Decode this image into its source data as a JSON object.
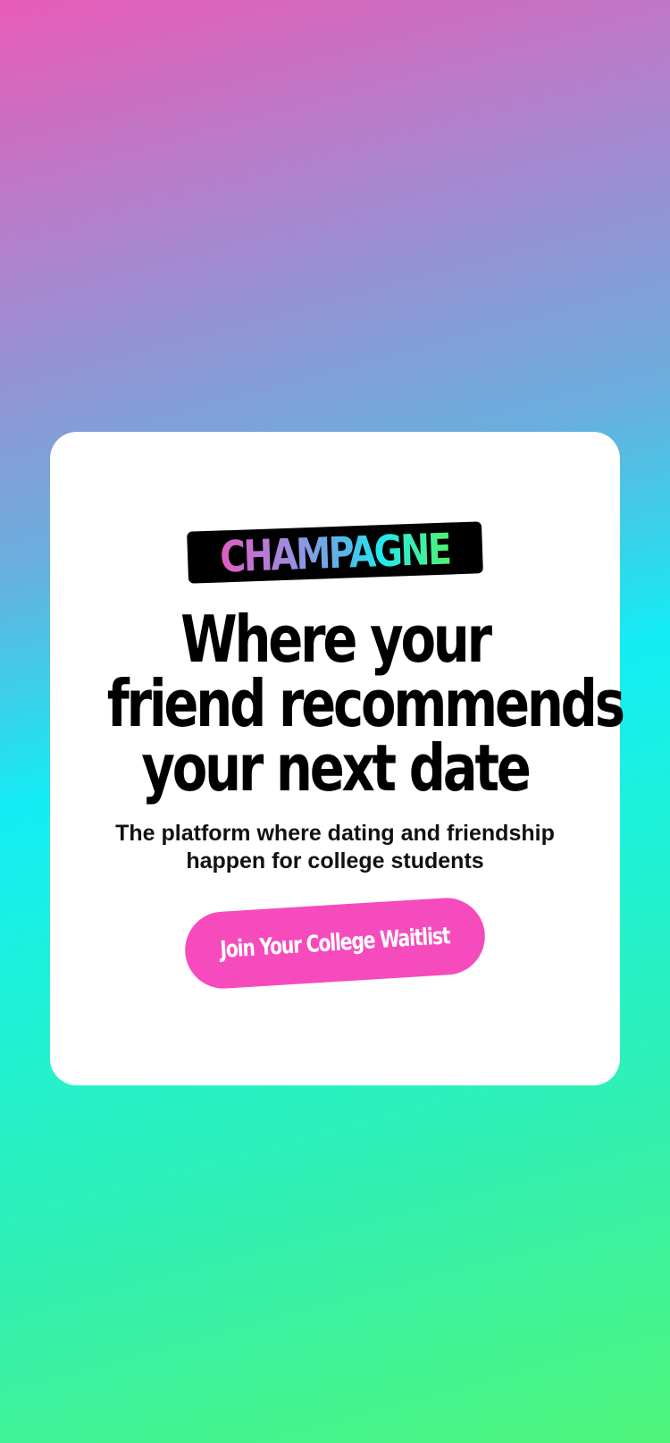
{
  "brand": {
    "logo_text": "CHAMPAGNE"
  },
  "hero": {
    "headline_lines": [
      "Where your",
      "friend recommends",
      "your next date"
    ],
    "subtitle_line1": "The platform where dating and friendship",
    "subtitle_line2": "happen for college students"
  },
  "cta": {
    "label": "Join Your College Waitlist"
  },
  "colors": {
    "cta_background": "#f54bbd",
    "card_background": "#ffffff",
    "gradient_top": "#e85bb8",
    "gradient_middle": "#14ecf5",
    "gradient_bottom": "#4ff57a"
  }
}
